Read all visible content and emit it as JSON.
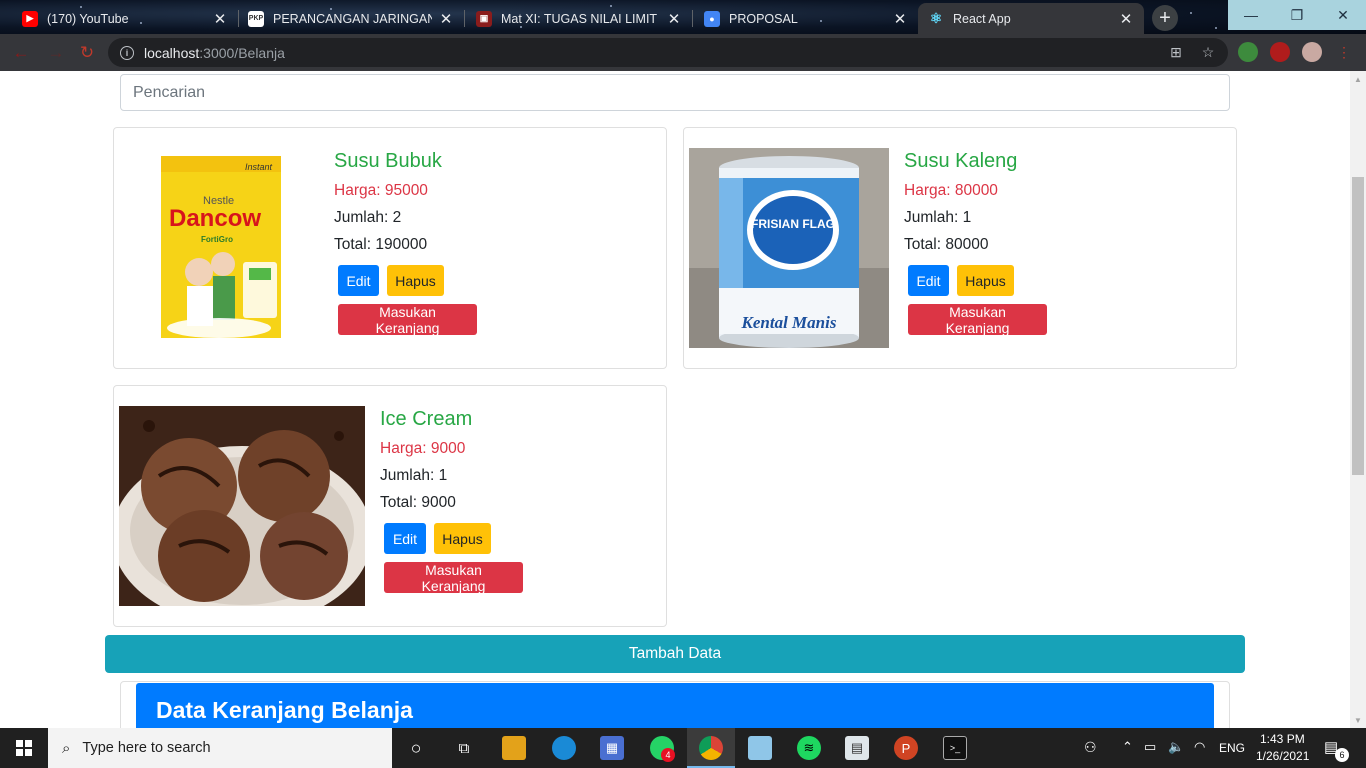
{
  "browser": {
    "tabs": [
      {
        "title": "(170) YouTube",
        "icon": "youtube-icon"
      },
      {
        "title": "PERANCANGAN JARINGAN KO",
        "icon": "pkp-icon"
      },
      {
        "title": "Mat XI: TUGAS NILAI LIMIT TA",
        "icon": "classroom-icon"
      },
      {
        "title": "PROPOSAL",
        "icon": "google-forms-icon"
      },
      {
        "title": "React App",
        "icon": "react-icon"
      }
    ],
    "active_tab": 4,
    "url_host": "localhost",
    "url_path": ":3000/Belanja"
  },
  "page": {
    "search": {
      "placeholder": "Pencarian",
      "value": ""
    },
    "products": [
      {
        "name": "Susu Bubuk",
        "price": "Harga: 95000",
        "qty": "Jumlah: 2",
        "total": "Total: 190000",
        "image": "dancow-milk-powder-box"
      },
      {
        "name": "Susu Kaleng",
        "price": "Harga: 80000",
        "qty": "Jumlah: 1",
        "total": "Total: 80000",
        "image": "frisian-flag-condensed-milk-can"
      },
      {
        "name": "Ice Cream",
        "price": "Harga: 9000",
        "qty": "Jumlah: 1",
        "total": "Total: 9000",
        "image": "chocolate-ice-cream-bowl"
      }
    ],
    "buttons": {
      "edit": "Edit",
      "delete": "Hapus",
      "add_to_cart": "Masukan Keranjang"
    },
    "add_data_button": "Tambah Data",
    "cart_title": "Data Keranjang Belanja",
    "image_text": {
      "dancow_brand": "Dancow",
      "dancow_nestle": "Nestle",
      "dancow_instant": "Instant",
      "frisian_brand": "FRISIAN FLAG",
      "frisian_product": "Kental Manis"
    },
    "colors": {
      "name": "#28a745",
      "price": "#dc3545",
      "edit": "#007bff",
      "delete": "#ffc107",
      "cart": "#dc3545",
      "add_data": "#17a2b8",
      "cart_header": "#007bff"
    }
  },
  "taskbar": {
    "search_placeholder": "Type here to search",
    "whatsapp_badge": "4",
    "language": "ENG",
    "time": "1:43 PM",
    "date": "1/26/2021",
    "notifications": "6"
  }
}
